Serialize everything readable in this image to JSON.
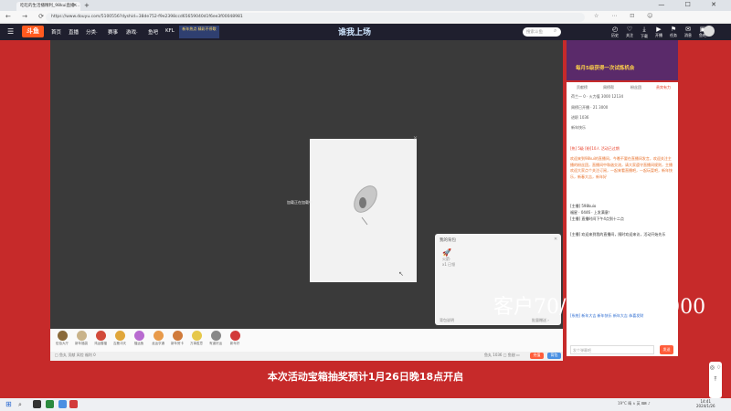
{
  "browser": {
    "tab_title": "吃吃的生活播精利_98kui直播 ...",
    "tab_close": "×",
    "new_tab": "+",
    "window_controls": "— ☐ ✕",
    "nav": "← → ⟳ ⌂",
    "url": "https://www.douyu.com/5100556?dyshid=38de752-f9e2398ccd65659040d1f6ee3f00048981"
  },
  "site": {
    "logo": "斗鱼",
    "nav": [
      "首页",
      "直播",
      "分类·",
      "赛事",
      "游戏·",
      "鱼吧",
      "KFL"
    ],
    "promo": "新年热点 精彩不停歇",
    "banner": "谁我上场",
    "search_placeholder": "搜索斗鱼",
    "top_icons": [
      {
        "icon": "◴",
        "label": "历史"
      },
      {
        "icon": "♡",
        "label": "关注"
      },
      {
        "icon": "⤓",
        "label": "下载"
      },
      {
        "icon": "▶",
        "label": "开播"
      },
      {
        "icon": "⚑",
        "label": "任务"
      },
      {
        "icon": "✉",
        "label": "消息"
      },
      {
        "icon": "▣",
        "label": "鱼吧"
      }
    ]
  },
  "dialog": {
    "label": "加载正在加载中",
    "close": "✕"
  },
  "pack": {
    "title": "我的背包",
    "close": "✕",
    "item_label": "火箭·",
    "item_sub": "x1 已领",
    "foot_left": "背包说明",
    "foot_right": "批量赠送 ›"
  },
  "gifts": [
    {
      "label": "伍佰大厅",
      "color": "#8a6a3a"
    },
    {
      "label": "新年福袋",
      "color": "#c9b38a"
    },
    {
      "label": "鸿运赠福",
      "color": "#d24a3a"
    },
    {
      "label": "吉鹿冲天",
      "color": "#e0a63a"
    },
    {
      "label": "福运鱼",
      "color": "#b86ad0"
    },
    {
      "label": "龙运亨通",
      "color": "#e89a4a"
    },
    {
      "label": "新年贺卡",
      "color": "#d07a3a"
    },
    {
      "label": "万事胜意",
      "color": "#e6c84a"
    },
    {
      "label": "有道好运",
      "color": "#888888"
    },
    {
      "label": "新年好",
      "color": "#d23a3a"
    }
  ],
  "giftbar2": {
    "left": "□ 鱼丸 贡献 风险 福利 0",
    "right": "鱼丸 1036 □ 鱼翅 ▭",
    "send1": "充值",
    "send2": "背包"
  },
  "event_text": "本次活动宝箱抽奖预计1月26日晚18点开启",
  "ad": {
    "text": "每月5级获得一次试炼机会"
  },
  "chat": {
    "tabs": [
      "贡献榜",
      "周榜帮",
      "粉丝团",
      "贵宾有力"
    ],
    "rows": [
      "荷兰一 0 · 火力值 3000 12134",
      "周榜已开播 · 21 3000",
      "进职 1036",
      "新年快乐"
    ],
    "messages": [
      {
        "text": "[热] 5级 [粉]10人 活动已过期",
        "color": "#e8402a"
      },
      {
        "text": "欢迎来到98kui的直播间，今晚不要在直播间发言，欢迎关注主播的粉丝团，直播间中和谐交流，请大家遵守直播间规则，主播欢迎大家点个关注订阅，一起来看直播吧，一起玩耍吧，新年快乐，新春大吉，新年好",
        "color": "#e8702a"
      },
      {
        "text": "[主播] 598kuio",
        "color": "#333"
      },
      {
        "text": "福星 · 0446 · 上发满意！",
        "color": "#333"
      },
      {
        "text": "[主播] 直播时间下午4点到十二点",
        "color": "#333"
      },
      {
        "text": "[主播] 欢迎来到我的直播间，随时欢迎来访，活动开始先乐",
        "color": "#333"
      },
      {
        "text": "[系统] 新年大吉 新年快乐 新年大吉 恭喜发财",
        "color": "#2a6ad0"
      }
    ],
    "input_placeholder": "发个弹幕吧",
    "send": "发送"
  },
  "watermark": "客户70/H：Kooo3000",
  "side_buttons": "◎ ♢ ⤒",
  "taskbar": {
    "start": "⊞",
    "search": "⌕",
    "tray": "19°C 晴 ∧ 英 ⌨ ♪",
    "time": "14:41",
    "date": "2024/1/26"
  }
}
